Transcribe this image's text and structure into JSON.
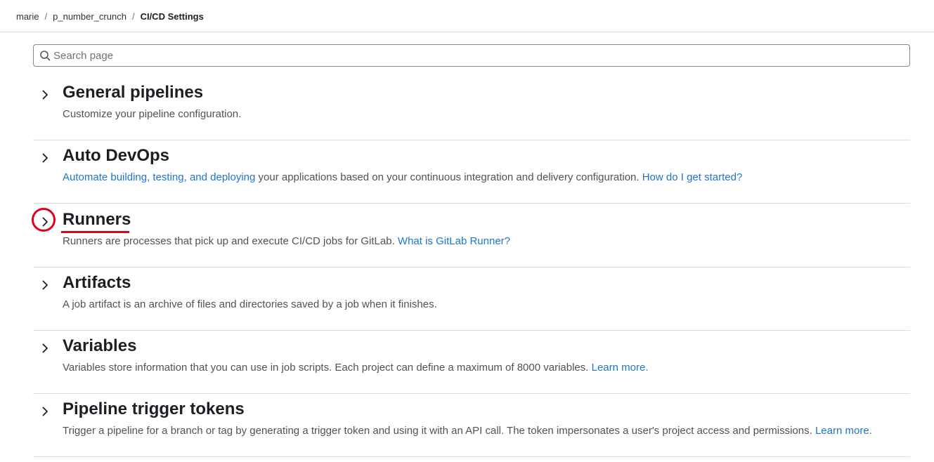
{
  "breadcrumb": {
    "items": [
      "marie",
      "p_number_crunch"
    ],
    "separator": "/",
    "current": "CI/CD Settings"
  },
  "search": {
    "placeholder": "Search page",
    "value": ""
  },
  "sections": {
    "general": {
      "title": "General pipelines",
      "desc": "Customize your pipeline configuration."
    },
    "autodevops": {
      "title": "Auto DevOps",
      "link1": "Automate building, testing, and deploying",
      "desc": " your applications based on your continuous integration and delivery configuration. ",
      "link2": "How do I get started?"
    },
    "runners": {
      "title": "Runners",
      "desc": "Runners are processes that pick up and execute CI/CD jobs for GitLab. ",
      "link": "What is GitLab Runner?"
    },
    "artifacts": {
      "title": "Artifacts",
      "desc": "A job artifact is an archive of files and directories saved by a job when it finishes."
    },
    "variables": {
      "title": "Variables",
      "desc": "Variables store information that you can use in job scripts. Each project can define a maximum of 8000 variables. ",
      "link": "Learn more."
    },
    "triggers": {
      "title": "Pipeline trigger tokens",
      "desc": "Trigger a pipeline for a branch or tag by generating a trigger token and using it with an API call. The token impersonates a user's project access and permissions. ",
      "link": "Learn more."
    }
  },
  "icons": {
    "search": "search-icon",
    "expand": "chevron-right-icon"
  },
  "colors": {
    "link": "#1f75cb",
    "annotation": "#e3001b",
    "divider": "#dcdcde"
  }
}
